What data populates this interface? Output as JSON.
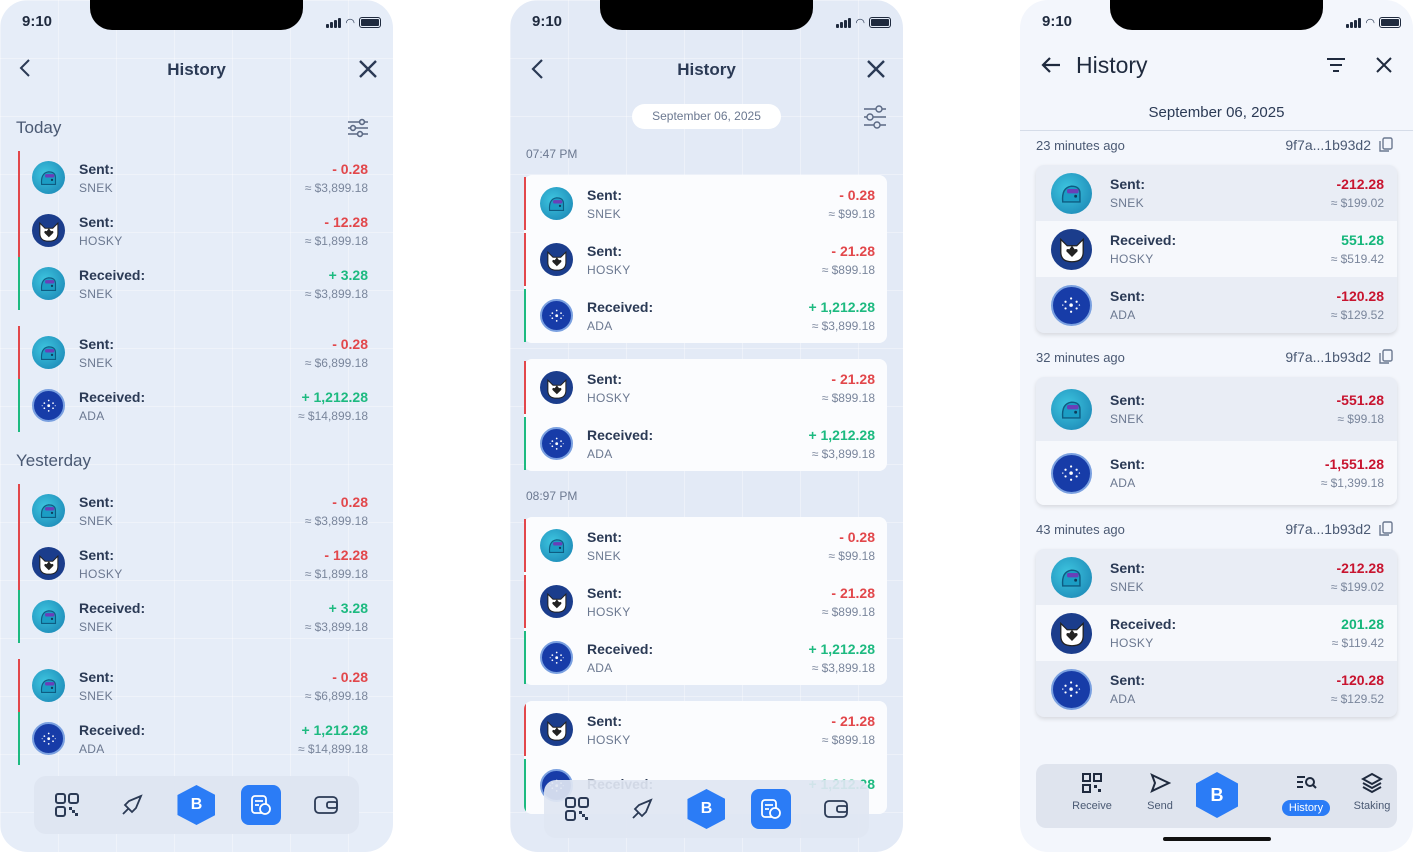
{
  "status_time": "9:10",
  "phone1": {
    "title": "History",
    "today_label": "Today",
    "yesterday_label": "Yesterday",
    "today_rows": [
      {
        "label": "Sent:",
        "token": "SNEK",
        "amount": "- 0.28",
        "fiat": "≈ $3,899.18",
        "kind": "sent",
        "asset": "snek"
      },
      {
        "label": "Sent:",
        "token": "HOSKY",
        "amount": "- 12.28",
        "fiat": "≈ $1,899.18",
        "kind": "sent",
        "asset": "hosky"
      },
      {
        "label": "Received:",
        "token": "SNEK",
        "amount": "+ 3.28",
        "fiat": "≈ $3,899.18",
        "kind": "received",
        "asset": "snek"
      },
      {
        "label": "Sent:",
        "token": "SNEK",
        "amount": "- 0.28",
        "fiat": "≈ $6,899.18",
        "kind": "sent",
        "asset": "snek"
      },
      {
        "label": "Received:",
        "token": "ADA",
        "amount": "+ 1,212.28",
        "fiat": "≈ $14,899.18",
        "kind": "received",
        "asset": "ada"
      }
    ],
    "yesterday_rows": [
      {
        "label": "Sent:",
        "token": "SNEK",
        "amount": "- 0.28",
        "fiat": "≈ $3,899.18",
        "kind": "sent",
        "asset": "snek"
      },
      {
        "label": "Sent:",
        "token": "HOSKY",
        "amount": "- 12.28",
        "fiat": "≈ $1,899.18",
        "kind": "sent",
        "asset": "hosky"
      },
      {
        "label": "Received:",
        "token": "SNEK",
        "amount": "+ 3.28",
        "fiat": "≈ $3,899.18",
        "kind": "received",
        "asset": "snek"
      },
      {
        "label": "Sent:",
        "token": "SNEK",
        "amount": "- 0.28",
        "fiat": "≈ $6,899.18",
        "kind": "sent",
        "asset": "snek"
      },
      {
        "label": "Received:",
        "token": "ADA",
        "amount": "+ 1,212.28",
        "fiat": "≈ $14,899.18",
        "kind": "received",
        "asset": "ada"
      }
    ]
  },
  "phone2": {
    "title": "History",
    "date": "September 06, 2025",
    "groups": [
      {
        "time": "07:47 PM",
        "cards": [
          [
            {
              "label": "Sent:",
              "token": "SNEK",
              "amount": "- 0.28",
              "fiat": "≈ $99.18",
              "kind": "sent",
              "asset": "snek"
            },
            {
              "label": "Sent:",
              "token": "HOSKY",
              "amount": "- 21.28",
              "fiat": "≈ $899.18",
              "kind": "sent",
              "asset": "hosky"
            },
            {
              "label": "Received:",
              "token": "ADA",
              "amount": "+ 1,212.28",
              "fiat": "≈ $3,899.18",
              "kind": "received",
              "asset": "ada"
            }
          ],
          [
            {
              "label": "Sent:",
              "token": "HOSKY",
              "amount": "- 21.28",
              "fiat": "≈ $899.18",
              "kind": "sent",
              "asset": "hosky"
            },
            {
              "label": "Received:",
              "token": "ADA",
              "amount": "+ 1,212.28",
              "fiat": "≈ $3,899.18",
              "kind": "received",
              "asset": "ada"
            }
          ]
        ]
      },
      {
        "time": "08:97 PM",
        "cards": [
          [
            {
              "label": "Sent:",
              "token": "SNEK",
              "amount": "- 0.28",
              "fiat": "≈ $99.18",
              "kind": "sent",
              "asset": "snek"
            },
            {
              "label": "Sent:",
              "token": "HOSKY",
              "amount": "- 21.28",
              "fiat": "≈ $899.18",
              "kind": "sent",
              "asset": "hosky"
            },
            {
              "label": "Received:",
              "token": "ADA",
              "amount": "+ 1,212.28",
              "fiat": "≈ $3,899.18",
              "kind": "received",
              "asset": "ada"
            }
          ],
          [
            {
              "label": "Sent:",
              "token": "HOSKY",
              "amount": "- 21.28",
              "fiat": "≈ $899.18",
              "kind": "sent",
              "asset": "hosky"
            },
            {
              "label": "Received:",
              "token": "",
              "amount": "+ 1,212.28",
              "fiat": "",
              "kind": "received",
              "asset": "ada"
            }
          ]
        ]
      }
    ]
  },
  "phone3": {
    "title": "History",
    "date": "September 06, 2025",
    "groups": [
      {
        "ago": "23 minutes ago",
        "hash": "9f7a...1b93d2",
        "rows": [
          {
            "label": "Sent:",
            "token": "SNEK",
            "amount": "-212.28",
            "fiat": "≈ $199.02",
            "kind": "sent",
            "asset": "snek"
          },
          {
            "label": "Received:",
            "token": "HOSKY",
            "amount": "551.28",
            "fiat": "≈ $519.42",
            "kind": "received",
            "asset": "hosky"
          },
          {
            "label": "Sent:",
            "token": "ADA",
            "amount": "-120.28",
            "fiat": "≈ $129.52",
            "kind": "sent",
            "asset": "ada"
          }
        ]
      },
      {
        "ago": "32 minutes ago",
        "hash": "9f7a...1b93d2",
        "rows": [
          {
            "label": "Sent:",
            "token": "SNEK",
            "amount": "-551.28",
            "fiat": "≈ $99.18",
            "kind": "sent",
            "asset": "snek"
          },
          {
            "label": "Sent:",
            "token": "ADA",
            "amount": "-1,551.28",
            "fiat": "≈ $1,399.18",
            "kind": "sent",
            "asset": "ada"
          }
        ]
      },
      {
        "ago": "43 minutes ago",
        "hash": "9f7a...1b93d2",
        "rows": [
          {
            "label": "Sent:",
            "token": "SNEK",
            "amount": "-212.28",
            "fiat": "≈ $199.02",
            "kind": "sent",
            "asset": "snek"
          },
          {
            "label": "Received:",
            "token": "HOSKY",
            "amount": "201.28",
            "fiat": "≈ $119.42",
            "kind": "received",
            "asset": "hosky"
          },
          {
            "label": "Sent:",
            "token": "ADA",
            "amount": "-120.28",
            "fiat": "≈ $129.52",
            "kind": "sent",
            "asset": "ada"
          }
        ]
      }
    ],
    "nav": [
      "Receive",
      "Send",
      "",
      "History",
      "Staking"
    ]
  },
  "colors": {
    "accent": "#2b7cf6",
    "negative": "#e2474b",
    "positive": "#1dba80"
  }
}
